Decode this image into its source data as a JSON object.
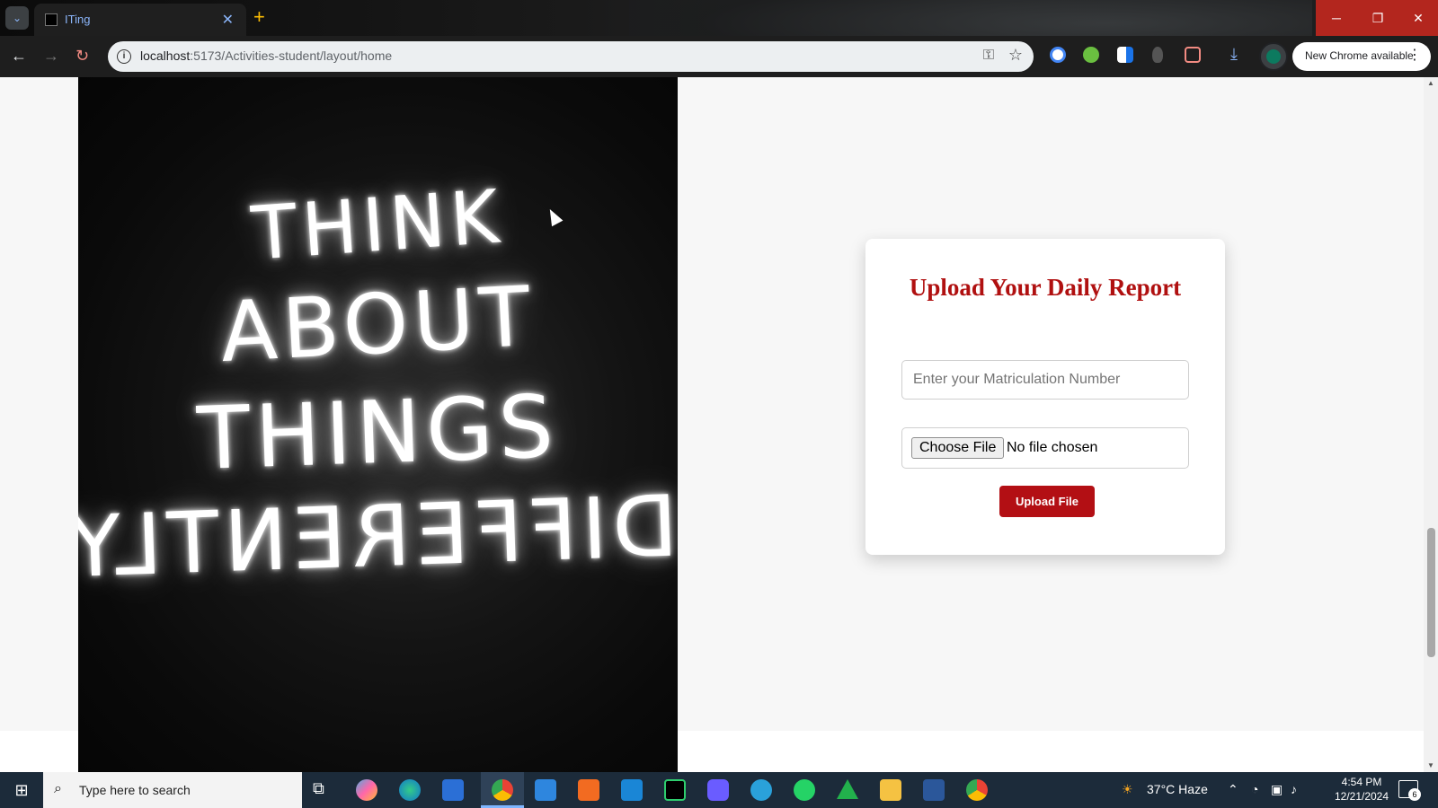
{
  "browser": {
    "tab_title": "ITing",
    "tab_favicon": "ITing favicon",
    "url_host": "localhost",
    "url_path": ":5173/Activities-student/layout/home",
    "update_label": "New Chrome available"
  },
  "hero": {
    "lines": [
      "THINK",
      "ABOUT",
      "THINGS",
      "DIFFERENTLY"
    ]
  },
  "form": {
    "title": "Upload Your Daily Report",
    "matric_placeholder": "Enter your Matriculation Number",
    "choose_file_label": "Choose File",
    "no_file_text": "No file chosen",
    "upload_label": "Upload File",
    "accent_color": "#b30f14"
  },
  "taskbar": {
    "search_placeholder": "Type here to search",
    "weather": "37°C  Haze",
    "time": "4:54 PM",
    "date": "12/21/2024",
    "notification_count": "6"
  }
}
